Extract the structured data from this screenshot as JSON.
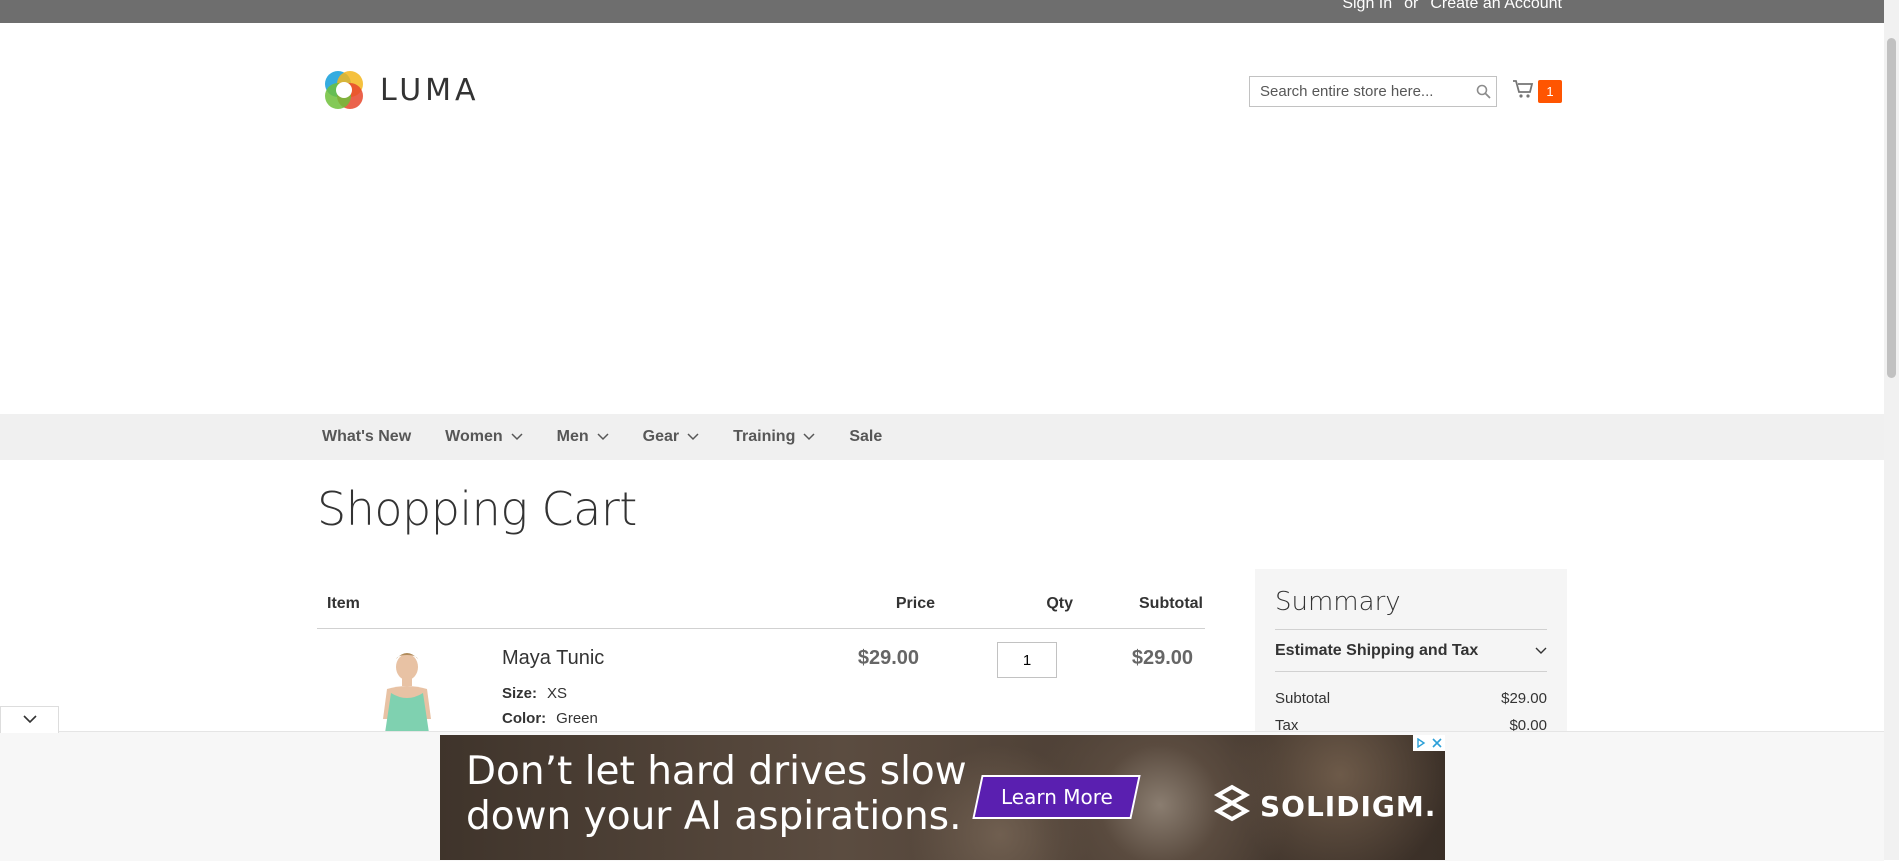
{
  "top_links": {
    "sign_in": "Sign In",
    "or": "or",
    "create_account": "Create an Account"
  },
  "logo": {
    "text": "LUMA"
  },
  "search": {
    "placeholder": "Search entire store here..."
  },
  "minicart": {
    "count": "1"
  },
  "nav": {
    "items": [
      {
        "label": "What's New",
        "has_dropdown": false
      },
      {
        "label": "Women",
        "has_dropdown": true
      },
      {
        "label": "Men",
        "has_dropdown": true
      },
      {
        "label": "Gear",
        "has_dropdown": true
      },
      {
        "label": "Training",
        "has_dropdown": true
      },
      {
        "label": "Sale",
        "has_dropdown": false
      }
    ]
  },
  "page": {
    "title": "Shopping Cart"
  },
  "cart": {
    "headers": {
      "item": "Item",
      "price": "Price",
      "qty": "Qty",
      "subtotal": "Subtotal"
    },
    "items": [
      {
        "name": "Maya Tunic",
        "price": "$29.00",
        "qty": "1",
        "subtotal": "$29.00",
        "options": [
          {
            "label": "Size:",
            "value": "XS"
          },
          {
            "label": "Color:",
            "value": "Green"
          }
        ]
      }
    ]
  },
  "summary": {
    "title": "Summary",
    "estimate_label": "Estimate Shipping and Tax",
    "subtotal_label": "Subtotal",
    "subtotal_value": "$29.00",
    "tax_label": "Tax",
    "tax_value": "$0.00"
  },
  "ad": {
    "headline_line1": "Don’t let hard drives slow",
    "headline_line2": "down your AI aspirations.",
    "cta": "Learn More",
    "brand": "SOLIDIGM."
  },
  "colors": {
    "accent": "#ff5501",
    "ad_cta": "#5a1fb0"
  }
}
